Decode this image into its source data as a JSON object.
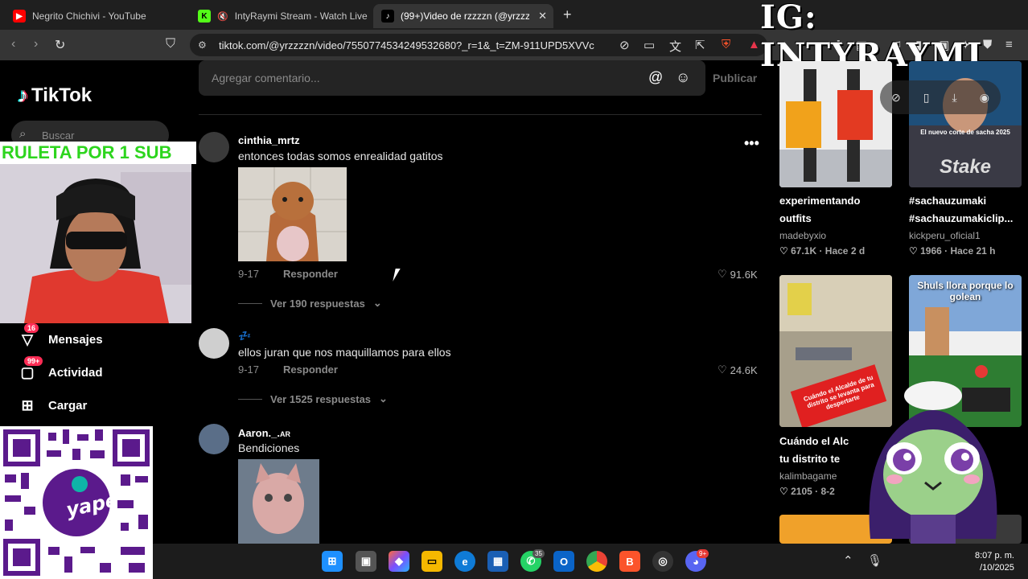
{
  "browser": {
    "tabs": [
      {
        "title": "Negrito Chichivi - YouTube",
        "favicon": "youtube-icon",
        "color": "#ff0000"
      },
      {
        "title": "IntyRaymi Stream - Watch Live on",
        "favicon": "kick-icon",
        "color": "#53fc18"
      },
      {
        "title": "(99+)Video de rzzzzn (@yrzzzzn)",
        "favicon": "tiktok-icon",
        "color": "#000000",
        "active": true
      }
    ],
    "url": "tiktok.com/@yrzzzzn/video/7550774534249532680?_r=1&_t=ZM-911UPD5XVVc"
  },
  "overlay": {
    "ig": "IG: INTYRAYMI",
    "ruleta": "RULETA POR 1 SUB"
  },
  "tiktok": {
    "logo": "TikTok",
    "search_placeholder": "Buscar",
    "nav": [
      {
        "label": "Mensajes",
        "icon": "paper-plane-icon",
        "badge": "16"
      },
      {
        "label": "Actividad",
        "icon": "inbox-icon",
        "badge": "99+"
      },
      {
        "label": "Cargar",
        "icon": "plus-square-icon"
      }
    ],
    "qr_label": "yape"
  },
  "comments": {
    "input_placeholder": "Agregar comentario...",
    "publish": "Publicar",
    "items": [
      {
        "user": "cinthia_mrtz",
        "text": "entonces todas somos enrealidad gatitos",
        "date": "9-17",
        "reply": "Responder",
        "likes": "91.6K",
        "more": "Ver 190 respuestas"
      },
      {
        "user": "",
        "text": "ellos juran que nos maquillamos para ellos",
        "date": "9-17",
        "reply": "Responder",
        "likes": "24.6K",
        "more": "Ver 1525 respuestas"
      },
      {
        "user": "Aaron._.",
        "user_suffix": "AR",
        "text": "Bendiciones"
      }
    ]
  },
  "videos": [
    {
      "title": "experimentando",
      "title2": "outfits",
      "author": "madebyxio",
      "likes": "67.1K",
      "time": "Hace 2 d"
    },
    {
      "title": "#sachauzumaki",
      "title2": "#sachauzumakiclip...",
      "author": "kickperu_oficial1",
      "likes": "1966",
      "time": "Hace 21 h",
      "thumb_caption": "El nuevo corte de sacha 2025",
      "brand": "Stake"
    },
    {
      "title": "Cuándo el Alc",
      "title2": "tu distrito te",
      "author": "kalimbagame",
      "likes": "2105",
      "time": "8-2",
      "thumb_caption": "Cuándo el Alcalde de tu distrito se levanta para despertarte"
    },
    {
      "title": "",
      "title2": "",
      "author": "",
      "likes": "",
      "time": "",
      "thumb_caption": "Shuls llora porque lo golean"
    }
  ],
  "taskbar": {
    "clock_time": "8:07 p. m.",
    "clock_date": "/10/2025",
    "whatsapp_badge": "35",
    "discord_badge": "9+"
  }
}
